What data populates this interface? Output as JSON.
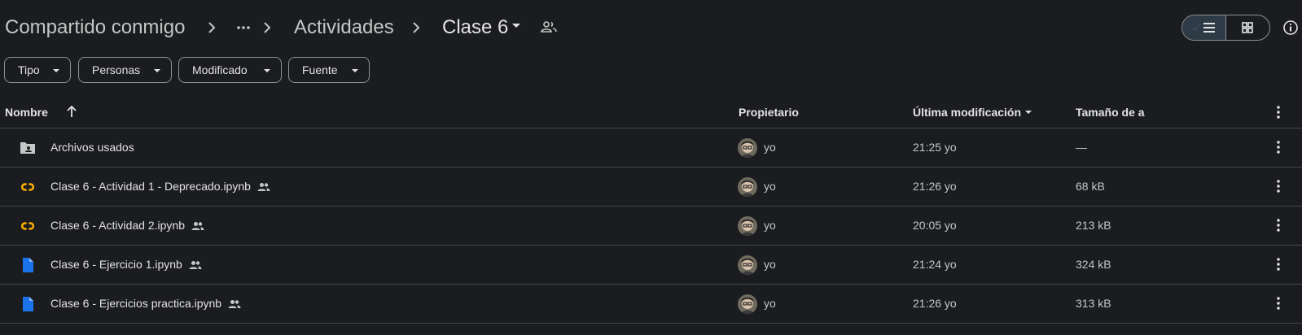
{
  "breadcrumb": {
    "root": "Compartido conmigo",
    "more": "···",
    "parent": "Actividades",
    "current": "Clase 6"
  },
  "filters": [
    "Tipo",
    "Personas",
    "Modificado",
    "Fuente"
  ],
  "table": {
    "headers": {
      "name": "Nombre",
      "owner": "Propietario",
      "modified": "Última modificación",
      "size": "Tamaño de a"
    },
    "rows": [
      {
        "type": "folder",
        "name": "Archivos usados",
        "shared": false,
        "owner": "yo",
        "modified": "21:25 yo",
        "size": "—"
      },
      {
        "type": "colab",
        "name": "Clase 6 - Actividad 1 - Deprecado.ipynb",
        "shared": true,
        "owner": "yo",
        "modified": "21:26 yo",
        "size": "68 kB"
      },
      {
        "type": "colab",
        "name": "Clase 6 - Actividad 2.ipynb",
        "shared": true,
        "owner": "yo",
        "modified": "20:05 yo",
        "size": "213 kB"
      },
      {
        "type": "doc",
        "name": "Clase 6 - Ejercicio 1.ipynb",
        "shared": true,
        "owner": "yo",
        "modified": "21:24 yo",
        "size": "324 kB"
      },
      {
        "type": "doc",
        "name": "Clase 6 - Ejercicios practica.ipynb",
        "shared": true,
        "owner": "yo",
        "modified": "21:26 yo",
        "size": "313 kB"
      }
    ]
  },
  "colors": {
    "background": "#1b1c1f",
    "text": "#e3e3e3",
    "muted": "#c4c7c5",
    "colab": "#f9ab00",
    "doc_blue": "#1a73e8",
    "toggle_active": "#2e3a46"
  },
  "icons": {
    "view_list": "list-view-icon",
    "view_grid": "grid-view-icon",
    "info": "info-icon",
    "shared": "people-icon",
    "sort": "arrow-up-icon",
    "row_menu": "more-vert-icon"
  }
}
